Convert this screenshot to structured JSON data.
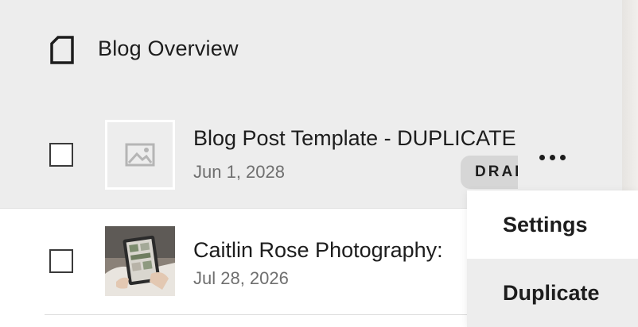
{
  "header": {
    "title": "Blog Overview",
    "icon": "page-icon"
  },
  "posts": [
    {
      "title": "Blog Post Template - DUPLICATE",
      "date": "Jun 1, 2028",
      "status": "DRAFT",
      "thumbnail": "image-placeholder-icon",
      "selected": false
    },
    {
      "title": "Caitlin Rose Photography:",
      "date": "Jul 28, 2026",
      "thumbnail": "photo-thumbnail",
      "selected": false
    }
  ],
  "row_actions": {
    "icon": "more-icon"
  },
  "context_menu": {
    "items": [
      {
        "label": "Settings"
      },
      {
        "label": "Duplicate"
      }
    ],
    "hovered": "Duplicate"
  },
  "colors": {
    "selected_row_bg": "#ededed",
    "badge_bg": "#d6d6d6",
    "text": "#1d1d1d",
    "muted_text": "#6f6f6f"
  }
}
